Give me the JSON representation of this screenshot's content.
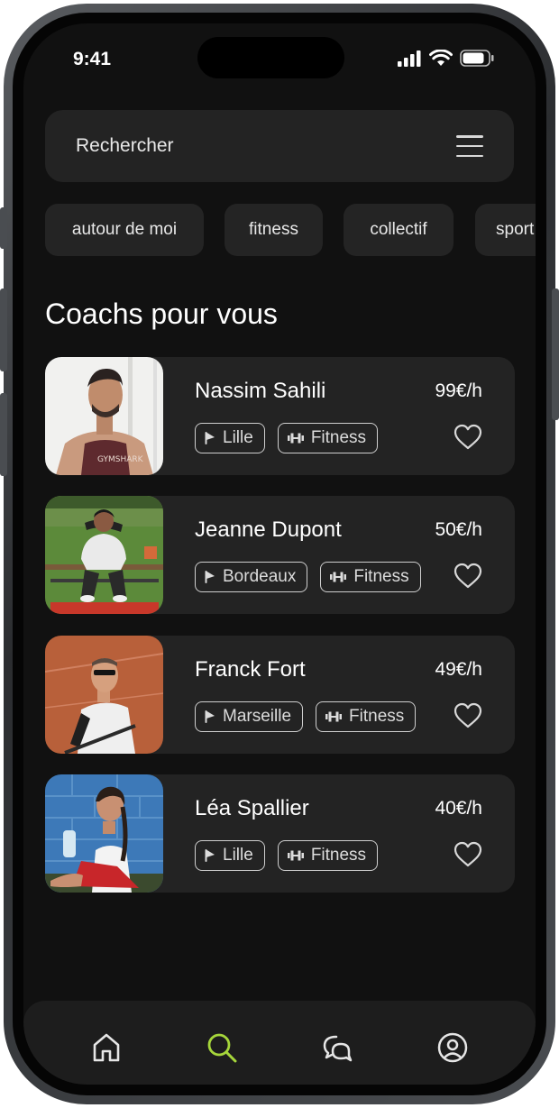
{
  "status_bar": {
    "time": "9:41"
  },
  "search": {
    "placeholder": "Rechercher"
  },
  "chips": [
    "autour de moi",
    "fitness",
    "collectif",
    "sport"
  ],
  "section": {
    "title": "Coachs pour vous"
  },
  "coaches": [
    {
      "name": "Nassim Sahili",
      "price": "99€/h",
      "city": "Lille",
      "category": "Fitness"
    },
    {
      "name": "Jeanne Dupont",
      "price": "50€/h",
      "city": "Bordeaux",
      "category": "Fitness"
    },
    {
      "name": "Franck Fort",
      "price": "49€/h",
      "city": "Marseille",
      "category": "Fitness"
    },
    {
      "name": "Léa Spallier",
      "price": "40€/h",
      "city": "Lille",
      "category": "Fitness"
    }
  ],
  "nav": [
    "home-icon",
    "search-icon",
    "chat-icon",
    "profile-icon"
  ],
  "colors": {
    "background": "#111111",
    "card": "#232323",
    "accent": "#a6d63b",
    "text": "#ffffff"
  }
}
